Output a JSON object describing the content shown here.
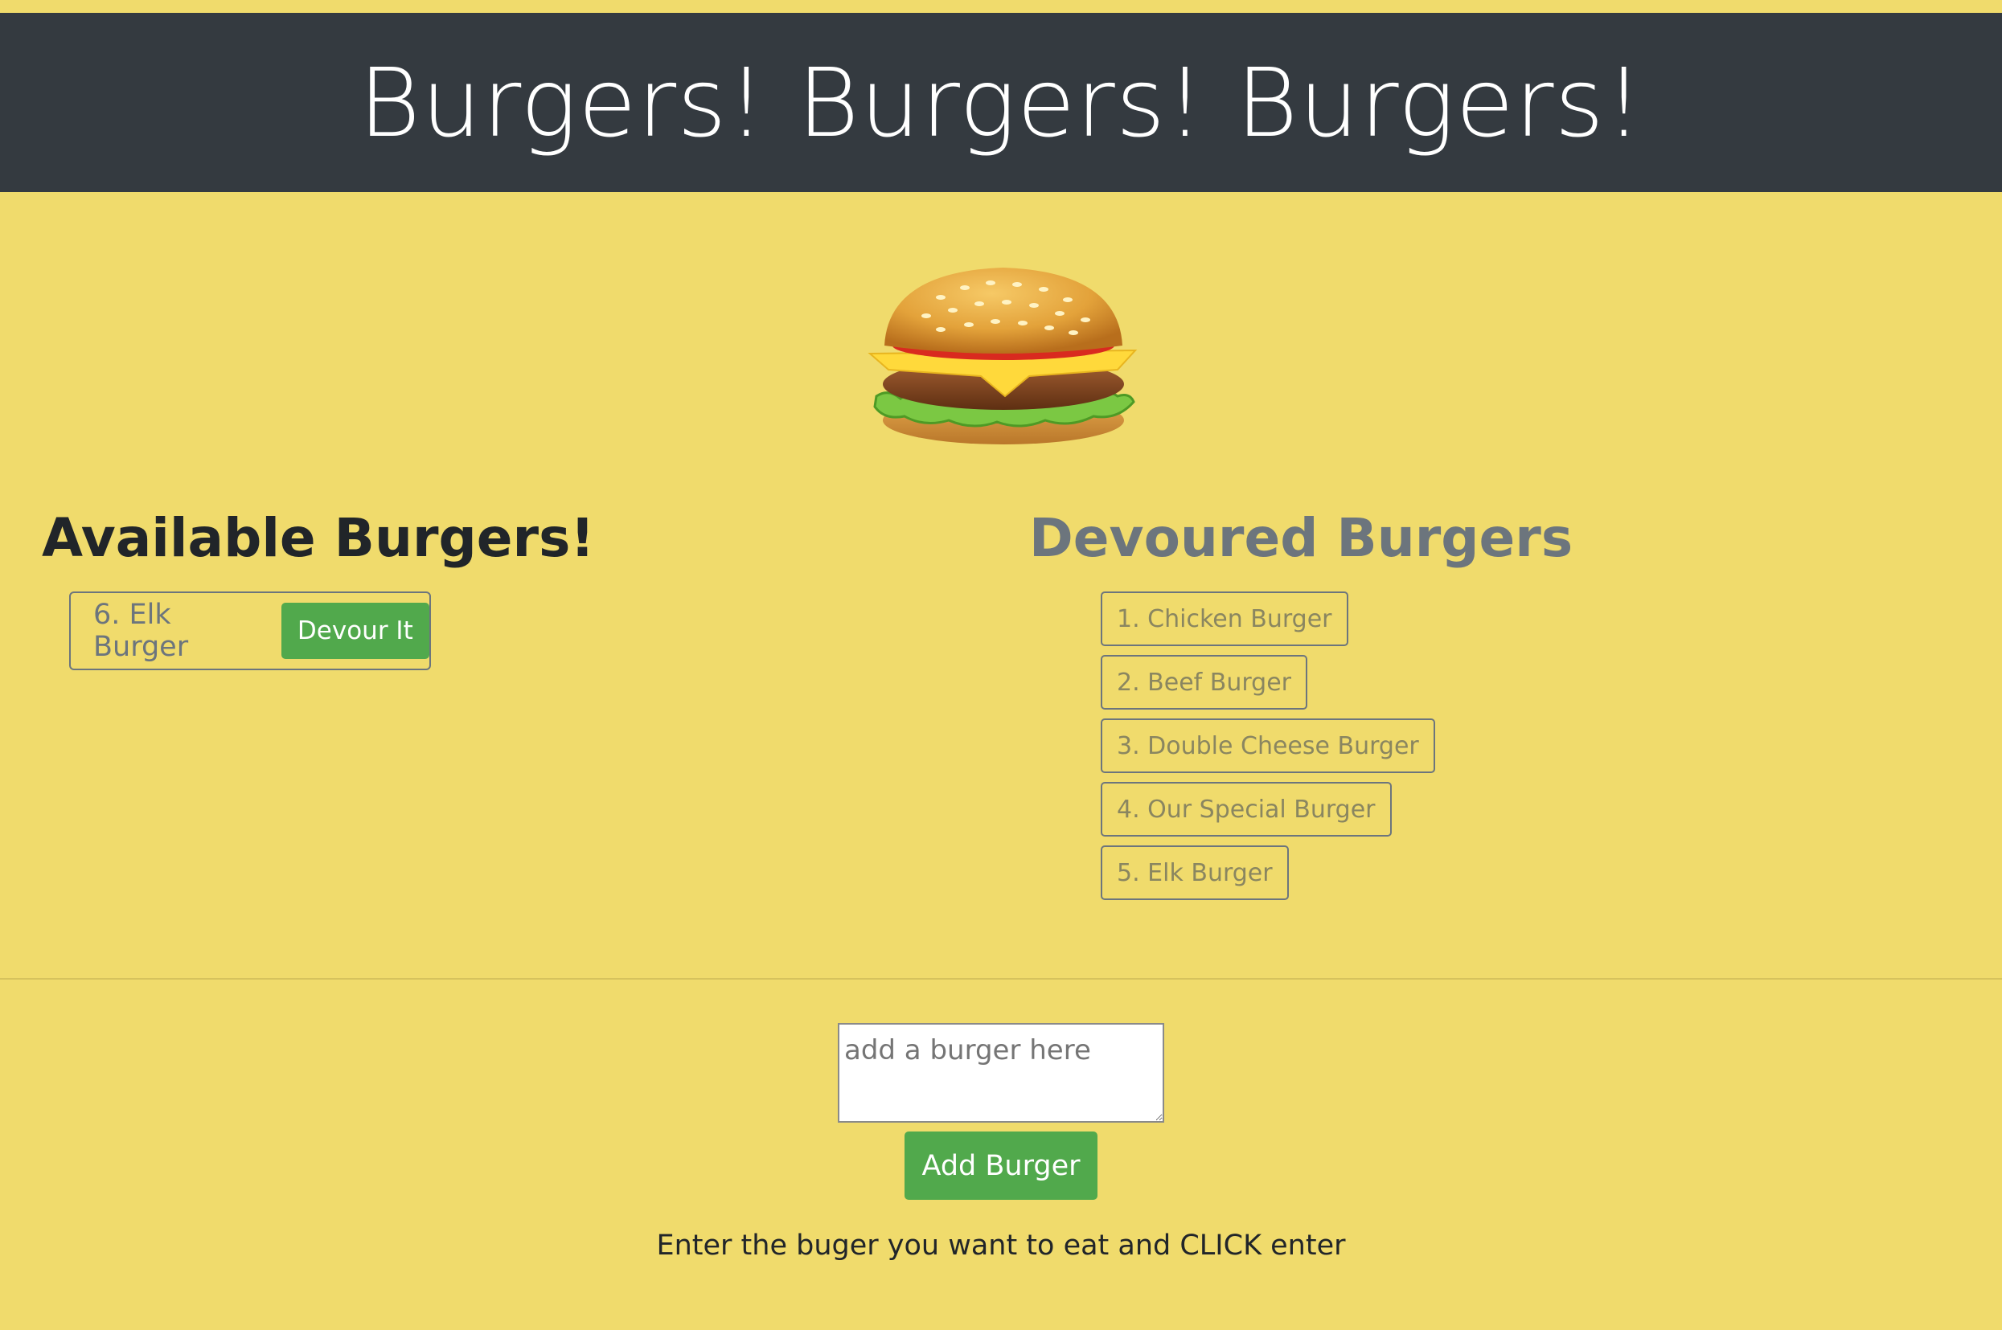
{
  "header": {
    "title": "Burgers! Burgers! Burgers!"
  },
  "hero": {
    "icon": "hamburger-icon"
  },
  "available": {
    "title": "Available Burgers!",
    "items": [
      {
        "label": "6. Elk Burger",
        "button": "Devour It"
      }
    ]
  },
  "devoured": {
    "title": "Devoured Burgers",
    "items": [
      "1. Chicken Burger",
      "2. Beef Burger",
      "3. Double Cheese Burger",
      "4. Our Special Burger",
      "5. Elk Burger"
    ]
  },
  "form": {
    "placeholder": "add a burger here",
    "value": "",
    "submit_label": "Add Burger",
    "hint": "Enter the buger you want to eat and CLICK enter"
  },
  "colors": {
    "header_bg": "#343a40",
    "page_bg": "#f0db6c",
    "button_green": "#51a94c"
  }
}
